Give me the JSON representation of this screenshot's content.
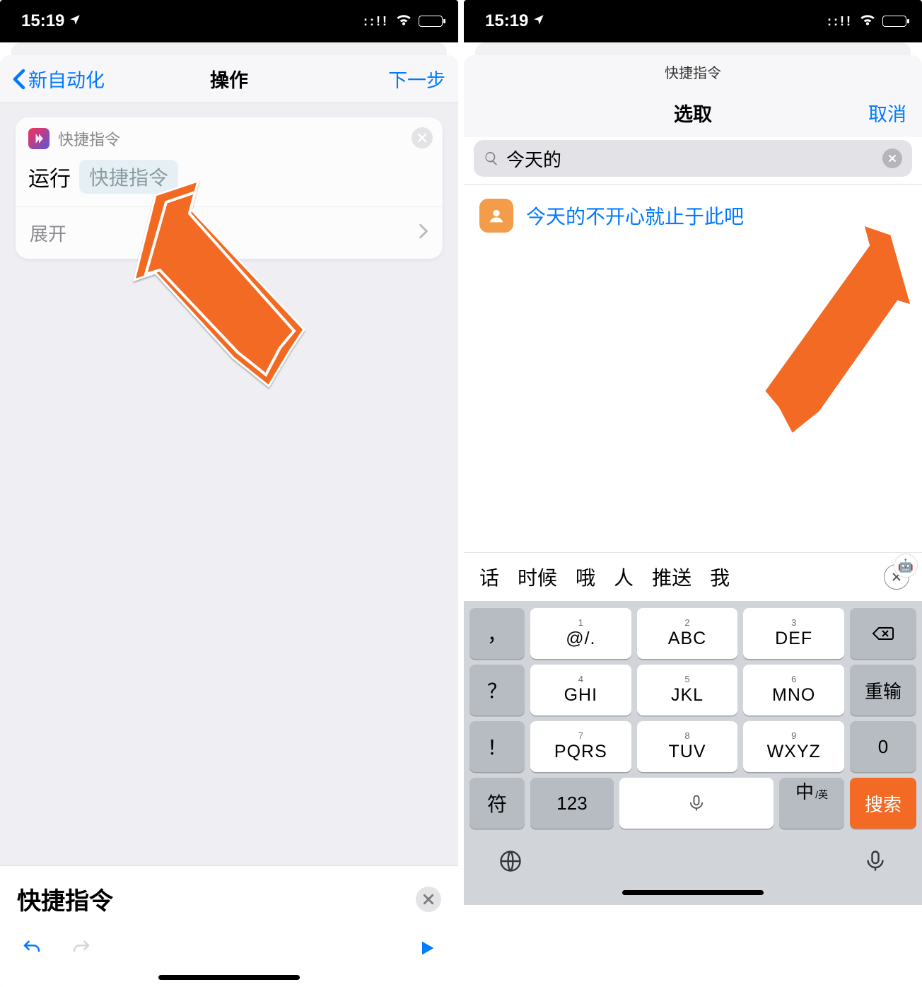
{
  "status": {
    "time": "15:19"
  },
  "left": {
    "nav": {
      "back": "新自动化",
      "title": "操作",
      "next": "下一步"
    },
    "card": {
      "app_label": "快捷指令",
      "run_label": "运行",
      "param_pill": "快捷指令",
      "expand_label": "展开"
    },
    "search_panel": {
      "text": "快捷指令"
    }
  },
  "right": {
    "app_name": "快捷指令",
    "nav": {
      "title": "选取",
      "cancel": "取消"
    },
    "search_value": "今天的",
    "result": "今天的不开心就止于此吧",
    "candidates": [
      "话",
      "时候",
      "哦",
      "人",
      "推送",
      "我"
    ],
    "keys": {
      "r1": [
        {
          "sup": "1",
          "main": "@/."
        },
        {
          "sup": "2",
          "main": "ABC"
        },
        {
          "sup": "3",
          "main": "DEF"
        }
      ],
      "r2": [
        {
          "sup": "4",
          "main": "GHI"
        },
        {
          "sup": "5",
          "main": "JKL"
        },
        {
          "sup": "6",
          "main": "MNO"
        }
      ],
      "r3": [
        {
          "sup": "7",
          "main": "PQRS"
        },
        {
          "sup": "8",
          "main": "TUV"
        },
        {
          "sup": "9",
          "main": "WXYZ"
        }
      ],
      "left_col": [
        "，",
        "？",
        "！"
      ],
      "right_col": {
        "retype": "重输",
        "zero": "0"
      },
      "bottom": {
        "sym": "符",
        "num": "123",
        "ime": "中",
        "ime_sub": "/英",
        "search": "搜索"
      }
    }
  }
}
